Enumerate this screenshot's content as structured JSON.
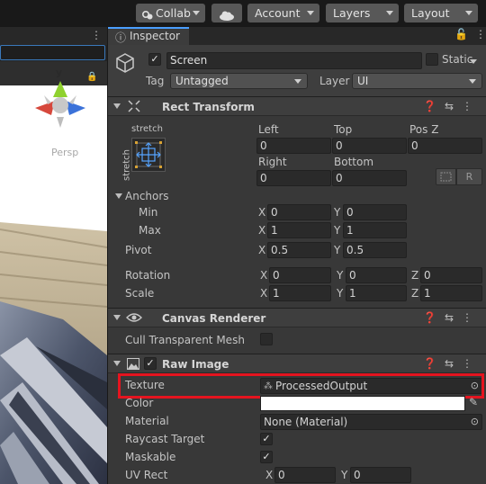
{
  "toolbar": {
    "collab": "Collab",
    "account": "Account",
    "layers": "Layers",
    "layout": "Layout"
  },
  "scene": {
    "axis_y": "y",
    "persp": "Persp"
  },
  "inspector": {
    "tab": "Inspector",
    "object_name": "Screen",
    "static_label": "Static",
    "tag_label": "Tag",
    "tag_value": "Untagged",
    "layer_label": "Layer",
    "layer_value": "UI"
  },
  "rect_transform": {
    "title": "Rect Transform",
    "anchor_preset_top": "stretch",
    "anchor_preset_side": "stretch",
    "left_label": "Left",
    "top_label": "Top",
    "posz_label": "Pos Z",
    "left": "0",
    "top": "0",
    "posz": "0",
    "right_label": "Right",
    "bottom_label": "Bottom",
    "right": "0",
    "bottom": "0",
    "r_button": "R",
    "anchors_label": "Anchors",
    "min_label": "Min",
    "max_label": "Max",
    "min_x": "0",
    "min_y": "0",
    "max_x": "1",
    "max_y": "1",
    "pivot_label": "Pivot",
    "pivot_x": "0.5",
    "pivot_y": "0.5",
    "rotation_label": "Rotation",
    "rot_x": "0",
    "rot_y": "0",
    "rot_z": "0",
    "scale_label": "Scale",
    "scale_x": "1",
    "scale_y": "1",
    "scale_z": "1",
    "x": "X",
    "y": "Y",
    "z": "Z"
  },
  "canvas_renderer": {
    "title": "Canvas Renderer",
    "cull_label": "Cull Transparent Mesh"
  },
  "raw_image": {
    "title": "Raw Image",
    "texture_label": "Texture",
    "texture_value": "ProcessedOutput",
    "color_label": "Color",
    "color_value": "#ffffff",
    "material_label": "Material",
    "material_value": "None (Material)",
    "raycast_label": "Raycast Target",
    "maskable_label": "Maskable",
    "uvrect_label": "UV Rect",
    "uv_x": "0",
    "uv_y": "0"
  }
}
